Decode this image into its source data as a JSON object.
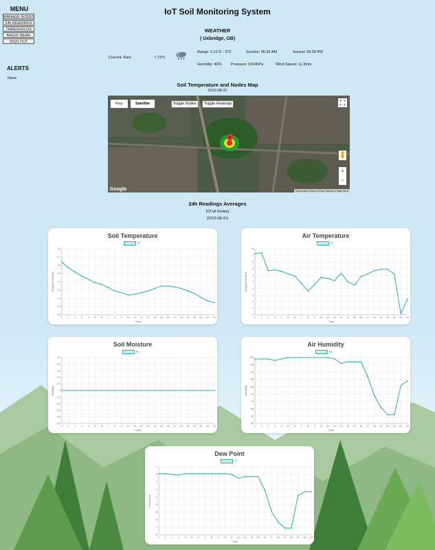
{
  "app": {
    "title": "IoT Soil Monitoring System"
  },
  "menu": {
    "title": "MENU",
    "items": [
      "MANAGE NODES",
      "24h READINGS",
      "THRESHOLDS",
      "MAGIC BEAN",
      "SIGN OUT"
    ]
  },
  "alerts": {
    "title": "ALERTS",
    "content": "None"
  },
  "weather": {
    "title": "WEATHER",
    "location": "( Uxbridge, GB)",
    "current_label": "Current: Rain",
    "current_temp": "7.73°C",
    "range": "Range: 6.11°C - 9°C",
    "sunrise": "Sunrise: 06:26 AM",
    "sunset": "Sunset: 05:58 PM",
    "humidity": "Humidity: 49%",
    "pressure": "Pressure: 1014hPa",
    "wind": "Wind Speed: 11.3m/s",
    "icon": "rain-cloud-icon"
  },
  "map_section": {
    "title": "Soil Temperature and Nodes Map",
    "date": "2013-08-31",
    "tab_map": "Map",
    "tab_satellite": "Satellite",
    "toggle_nodes": "Toggle Nodes",
    "toggle_heatmap": "Toggle Heatmap",
    "google": "Google",
    "attribution": "Map Data  Terms of Use  Report a map error",
    "zoom_in": "+",
    "zoom_out": "−"
  },
  "readings": {
    "title": "24h Readings Averages",
    "subtitle": "(Of all Nodes)",
    "date": "(2013-08-31)"
  },
  "colors": {
    "line": "#35b3ab",
    "fill": "rgba(47,176,168,0.25)",
    "grid": "#e4e4e4"
  },
  "chart_data": [
    {
      "type": "line",
      "title": "Soil Temperature",
      "legend": "C°",
      "xlabel": "Time",
      "ylabel": "Degrees Celsius",
      "x": [
        "0",
        "1",
        "2",
        "3",
        "4",
        "5",
        "6",
        "7",
        "8",
        "9",
        "10",
        "11",
        "12",
        "13",
        "14",
        "15",
        "16",
        "17",
        "18",
        "19",
        "20",
        "21",
        "22",
        "23"
      ],
      "yticks": [
        "1.8",
        "1.7",
        "1.6",
        "1.5",
        "1.4",
        "1.3",
        "1.2",
        "1.1",
        "1.0"
      ],
      "ylim": [
        1.0,
        1.8
      ],
      "values": [
        1.64,
        1.57,
        1.52,
        1.47,
        1.43,
        1.39,
        1.37,
        1.33,
        1.29,
        1.27,
        1.24,
        1.25,
        1.27,
        1.29,
        1.32,
        1.35,
        1.35,
        1.34,
        1.32,
        1.29,
        1.26,
        1.21,
        1.17,
        1.15
      ]
    },
    {
      "type": "line",
      "title": "Air Temperature",
      "legend": "C°",
      "xlabel": "Time",
      "ylabel": "Degrees Celsius",
      "x": [
        "0",
        "1",
        "2",
        "3",
        "4",
        "5",
        "6",
        "7",
        "8",
        "9",
        "10",
        "11",
        "12",
        "13",
        "14",
        "15",
        "16",
        "17",
        "18",
        "19",
        "20",
        "21",
        "22",
        "23"
      ],
      "yticks": [
        "8",
        "7",
        "6",
        "5",
        "4",
        "3",
        "2",
        "1",
        "0",
        "-1",
        "-2"
      ],
      "ylim": [
        -2,
        8
      ],
      "values": [
        7.3,
        7.4,
        4.7,
        4.8,
        4.6,
        4.2,
        3.9,
        2.8,
        1.6,
        2.6,
        3.7,
        3.5,
        3.2,
        4.3,
        3.0,
        2.5,
        3.8,
        4.2,
        4.7,
        4.9,
        4.9,
        4.2,
        -1.8,
        0.4
      ]
    },
    {
      "type": "line",
      "title": "Soil Moisture",
      "legend": "%",
      "xlabel": "Time",
      "ylabel": "Moisture",
      "x": [
        "0",
        "1",
        "2",
        "3",
        "4",
        "5",
        "6",
        "7",
        "8",
        "9",
        "10",
        "11",
        "12",
        "13",
        "14",
        "15",
        "16",
        "17",
        "18",
        "19",
        "20",
        "21",
        "22",
        "23"
      ],
      "yticks": [
        "1.0",
        "0.8",
        "0.6",
        "0.4",
        "0.2",
        "0",
        "-0.2",
        "-0.4",
        "-0.6",
        "-0.8",
        "-1.0"
      ],
      "ylim": [
        -1.0,
        1.0
      ],
      "values": [
        0,
        0,
        0,
        0,
        0,
        0,
        0,
        0,
        0,
        0,
        0,
        0,
        0,
        0,
        0,
        0,
        0,
        0,
        0,
        0,
        0,
        0,
        0,
        0
      ]
    },
    {
      "type": "line",
      "title": "Air Humidity",
      "legend": "%",
      "xlabel": "Time",
      "ylabel": "Humidity",
      "x": [
        "0",
        "1",
        "2",
        "3",
        "4",
        "5",
        "6",
        "7",
        "8",
        "9",
        "10",
        "11",
        "12",
        "13",
        "14",
        "15",
        "16",
        "17",
        "18",
        "19",
        "20",
        "21",
        "22",
        "23"
      ],
      "yticks": [
        "100",
        "95",
        "90",
        "85",
        "80",
        "75",
        "70",
        "65",
        "60",
        "55"
      ],
      "ylim": [
        55,
        100
      ],
      "values": [
        99,
        99,
        99,
        98,
        99,
        100,
        100,
        100,
        100,
        100,
        100,
        100,
        99,
        96,
        97,
        97,
        97,
        87,
        74,
        66,
        61,
        61,
        81,
        84
      ]
    },
    {
      "type": "line",
      "title": "Dew Point",
      "legend": "C°",
      "xlabel": "Time",
      "ylabel": "Dew Point",
      "x": [
        "0",
        "1",
        "2",
        "3",
        "4",
        "5",
        "6",
        "7",
        "8",
        "9",
        "10",
        "11",
        "12",
        "13",
        "14",
        "15",
        "16",
        "17",
        "18",
        "19",
        "20",
        "21",
        "22",
        "23"
      ],
      "yticks": [
        "1",
        "0",
        "-1",
        "-2",
        "-3",
        "-4",
        "-5",
        "-6",
        "-7",
        "-8"
      ],
      "ylim": [
        -8,
        1
      ],
      "values": [
        0.1,
        0.1,
        0.0,
        -0.1,
        0.1,
        0.1,
        0.1,
        0.1,
        0.1,
        0.1,
        0.1,
        0.0,
        -0.5,
        -0.3,
        -0.3,
        -0.3,
        -2.1,
        -4.9,
        -6.3,
        -7.1,
        -7.1,
        -2.8,
        -2.3,
        -2.3
      ]
    }
  ]
}
